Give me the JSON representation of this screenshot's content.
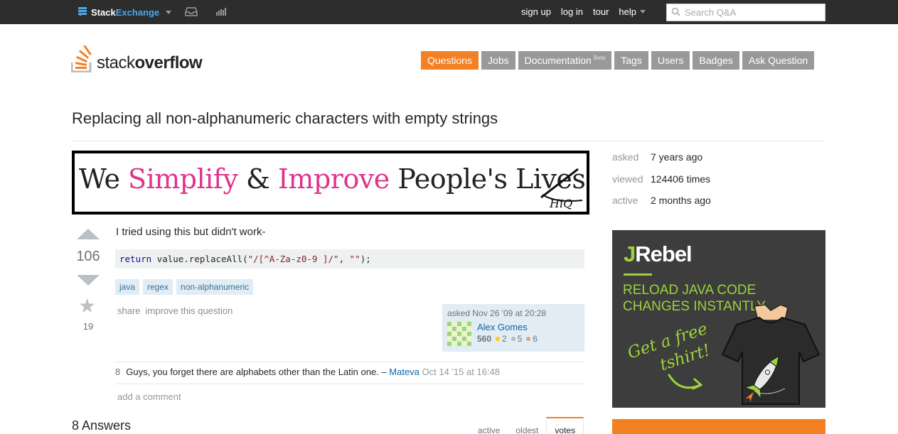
{
  "topbar": {
    "brand_main": "Stack",
    "brand_accent": "Exchange",
    "links": [
      "sign up",
      "log in",
      "tour"
    ],
    "help_label": "help",
    "search_placeholder": "Search Q&A"
  },
  "logo": {
    "word_light": "stack",
    "word_bold": "overflow"
  },
  "nav": {
    "tabs": [
      "Questions",
      "Jobs",
      "Documentation",
      "Tags",
      "Users",
      "Badges",
      "Ask Question"
    ],
    "documentation_badge": "Beta",
    "active": "Questions"
  },
  "question": {
    "title": "Replacing all non-alphanumeric characters with empty strings",
    "votes": "106",
    "favorites": "19",
    "body": "I tried using this but didn't work-",
    "code": {
      "kw": "return",
      "pre": " value.replaceAll(",
      "arg1": "\"/[^A-Za-z0-9 ]/\"",
      "sep": ", ",
      "arg2": "\"\"",
      "post": ");"
    },
    "tags": [
      "java",
      "regex",
      "non-alphanumeric"
    ],
    "menu": [
      "share",
      "improve this question"
    ],
    "asked": {
      "time": "asked Nov 26 '09 at 20:28",
      "user": "Alex Gomes",
      "rep": "560",
      "gold": "2",
      "silver": "5",
      "bronze": "6"
    },
    "comment": {
      "score": "8",
      "text": "Guys, you forget there are alphabets other than the Latin one. –",
      "author": "Mateva",
      "when": "Oct 14 '15 at 16:48"
    },
    "add_comment": "add a comment"
  },
  "banner": {
    "w1": "We ",
    "w2": "Simplify",
    "w3": " & ",
    "w4": "Improve",
    "w5": " People's Lives!",
    "signature": "HiQ"
  },
  "answers": {
    "heading": "8 Answers",
    "sort_tabs": [
      "active",
      "oldest",
      "votes"
    ],
    "active_sort": "votes"
  },
  "sidebar": {
    "stats": [
      {
        "key": "asked",
        "value": "7 years ago"
      },
      {
        "key": "viewed",
        "value": "124406 times"
      },
      {
        "key": "active",
        "value": "2 months ago"
      }
    ],
    "ad": {
      "logo_j": "J",
      "logo_rest": "Rebel",
      "headline": "RELOAD JAVA CODE CHANGES INSTANTLY",
      "script_line1": "Get a free",
      "script_line2": "tshirt!"
    }
  },
  "colors": {
    "accent": "#f48024",
    "topbar": "#2d2d2d",
    "link": "#0c65a5",
    "tag_bg": "#e1ecf4",
    "jrebel_green": "#9cd33b",
    "banner_pink": "#e0338c"
  }
}
